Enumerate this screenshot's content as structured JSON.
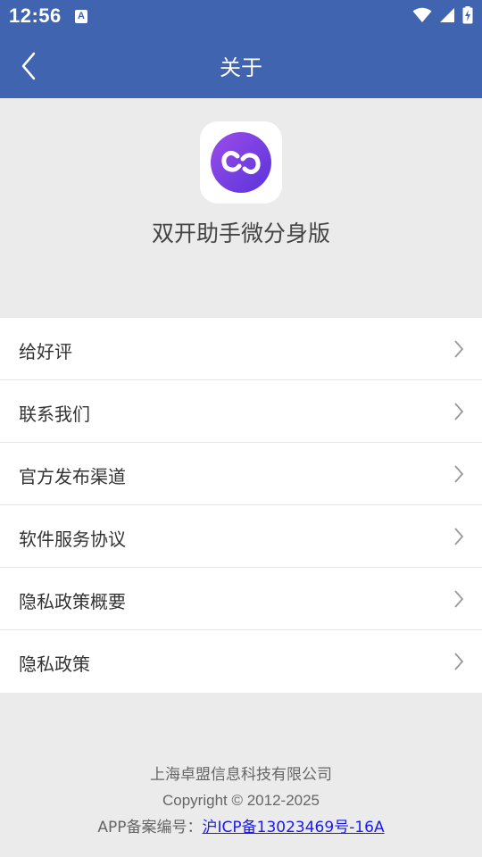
{
  "status_bar": {
    "time": "12:56",
    "notification_glyph": "A",
    "icons": [
      "wifi-icon",
      "cellular-signal-icon",
      "battery-charging-icon"
    ]
  },
  "nav": {
    "title": "关于",
    "back_icon": "chevron-left-icon"
  },
  "app": {
    "name": "双开助手微分身版",
    "icon": "infinity-logo-icon"
  },
  "menu": {
    "items": [
      {
        "label": "给好评"
      },
      {
        "label": "联系我们"
      },
      {
        "label": "官方发布渠道"
      },
      {
        "label": "软件服务协议"
      },
      {
        "label": "隐私政策概要"
      },
      {
        "label": "隐私政策"
      }
    ]
  },
  "footer": {
    "company": "上海卓盟信息科技有限公司",
    "copyright": "Copyright © 2012-2025",
    "icp_prefix": "APP备案编号：",
    "icp_link": "沪ICP备13023469号-16A"
  },
  "colors": {
    "header_bg": "#4064b0",
    "page_bg": "#ebebeb",
    "logo_purple": "#7a3de8",
    "link_blue": "#1a1aee"
  }
}
